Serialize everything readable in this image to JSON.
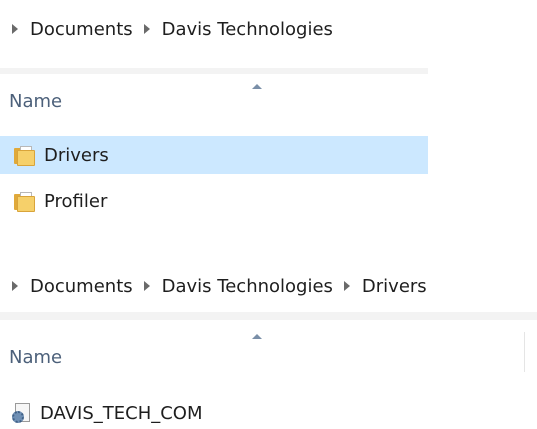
{
  "panel1": {
    "breadcrumb": [
      "Documents",
      "Davis Technologies"
    ],
    "column_header": "Name",
    "items": [
      {
        "name": "Drivers",
        "type": "folder",
        "selected": true
      },
      {
        "name": "Profiler",
        "type": "folder",
        "selected": false
      }
    ]
  },
  "panel2": {
    "breadcrumb": [
      "Documents",
      "Davis Technologies",
      "Drivers"
    ],
    "column_header": "Name",
    "items": [
      {
        "name": "DAVIS_TECH_COM",
        "type": "file",
        "selected": false
      }
    ]
  },
  "colors": {
    "selection": "#cce8ff",
    "header_text": "#4c607a",
    "folder": "#f6d06a"
  }
}
